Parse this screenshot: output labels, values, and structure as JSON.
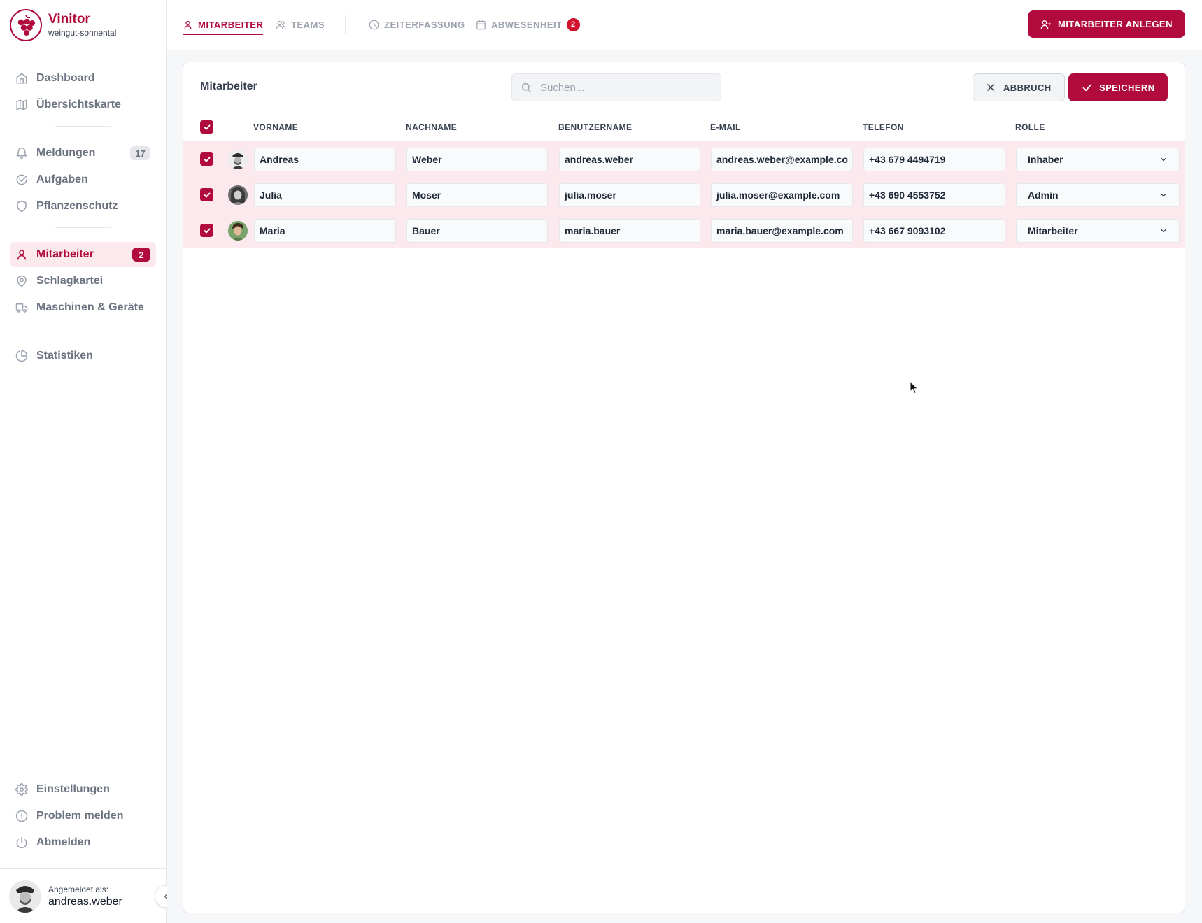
{
  "brand": {
    "name": "Vinitor",
    "subtitle": "weingut-sonnental"
  },
  "sidebar": {
    "groups": [
      [
        {
          "label": "Dashboard",
          "icon": "home-icon"
        },
        {
          "label": "Übersichtskarte",
          "icon": "map-icon"
        }
      ],
      [
        {
          "label": "Meldungen",
          "icon": "bell-icon",
          "count": "17"
        },
        {
          "label": "Aufgaben",
          "icon": "check-circle-icon"
        },
        {
          "label": "Pflanzenschutz",
          "icon": "shield-icon"
        }
      ],
      [
        {
          "label": "Mitarbeiter",
          "icon": "user-icon",
          "count": "2",
          "active": true
        },
        {
          "label": "Schlagkartei",
          "icon": "map-pin-icon"
        },
        {
          "label": "Maschinen & Geräte",
          "icon": "truck-icon"
        }
      ],
      [
        {
          "label": "Statistiken",
          "icon": "pie-chart-icon"
        }
      ]
    ],
    "bottom": [
      {
        "label": "Einstellungen",
        "icon": "gear-icon"
      },
      {
        "label": "Problem melden",
        "icon": "alert-circle-icon"
      },
      {
        "label": "Abmelden",
        "icon": "power-icon"
      }
    ],
    "user": {
      "caption": "Angemeldet als:",
      "name": "andreas.weber"
    }
  },
  "topbar": {
    "tabs": [
      {
        "label": "MITARBEITER",
        "icon": "user-icon",
        "active": true
      },
      {
        "label": "TEAMS",
        "icon": "users-icon"
      },
      {
        "label": "ZEITERFASSUNG",
        "icon": "clock-icon"
      },
      {
        "label": "ABWESENHEIT",
        "icon": "calendar-icon",
        "badge": "2"
      }
    ],
    "primary_button": "MITARBEITER ANLEGEN"
  },
  "card": {
    "title": "Mitarbeiter",
    "search_placeholder": "Suchen...",
    "cancel_label": "ABBRUCH",
    "save_label": "SPEICHERN",
    "columns": [
      "VORNAME",
      "NACHNAME",
      "BENUTZERNAME",
      "E-MAIL",
      "TELEFON",
      "ROLLE"
    ],
    "rows": [
      {
        "checked": true,
        "first": "Andreas",
        "last": "Weber",
        "username": "andreas.weber",
        "email": "andreas.weber@example.co",
        "phone": "+43 679 4494719",
        "role": "Inhaber"
      },
      {
        "checked": true,
        "first": "Julia",
        "last": "Moser",
        "username": "julia.moser",
        "email": "julia.moser@example.com",
        "phone": "+43 690 4553752",
        "role": "Admin"
      },
      {
        "checked": true,
        "first": "Maria",
        "last": "Bauer",
        "username": "maria.bauer",
        "email": "maria.bauer@example.com",
        "phone": "+43 667 9093102",
        "role": "Mitarbeiter"
      }
    ]
  },
  "colors": {
    "accent": "#b00b3c",
    "accent_light": "#fbe9ee",
    "badge_red": "#d1122f"
  }
}
